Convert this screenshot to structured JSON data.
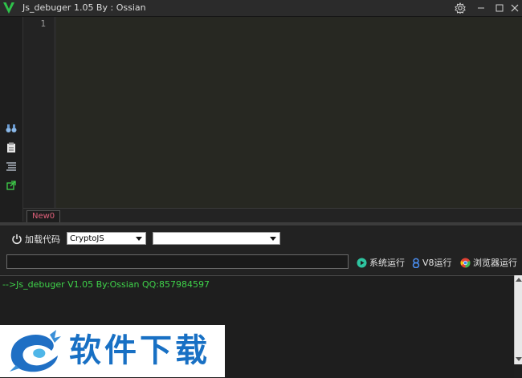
{
  "window": {
    "title": "Js_debuger 1.05 By : Ossian"
  },
  "editor": {
    "line_numbers": [
      "1"
    ],
    "tabs": [
      {
        "label": "New0"
      }
    ]
  },
  "toolbar": {
    "load_code_label": "加载代码",
    "library_select": {
      "value": "CryptoJS"
    },
    "secondary_select": {
      "value": ""
    }
  },
  "run_bar": {
    "command_input": {
      "value": ""
    },
    "system_run_label": "系统运行",
    "v8_run_label": "V8运行",
    "browser_run_label": "浏览器运行"
  },
  "console": {
    "text": "-->Js_debuger V1.05 By:Ossian QQ:857984597"
  },
  "watermark": {
    "text": "软件下载"
  },
  "colors": {
    "accent_green": "#3fd24a",
    "tab_pink": "#e0607a",
    "watermark_blue": "#1870c4"
  }
}
